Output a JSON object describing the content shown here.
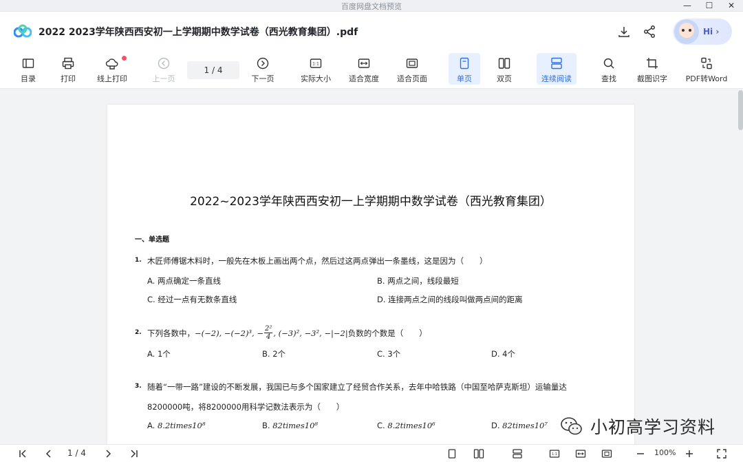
{
  "window": {
    "title": "百度网盘文档预览"
  },
  "header": {
    "file_title": "2022 2023学年陕西西安初一上学期期中数学试卷（西光教育集团）.pdf",
    "hi_label": "Hi ›"
  },
  "toolbar": {
    "toc": "目录",
    "print": "打印",
    "online_print": "线上打印",
    "prev": "上一页",
    "page": "1 / 4",
    "next": "下一页",
    "actual_size": "实际大小",
    "fit_width": "适合宽度",
    "fit_page": "适合页面",
    "single": "单页",
    "double": "双页",
    "continuous": "连续阅读",
    "find": "查找",
    "ocr": "截图识字",
    "to_word": "PDF转Word"
  },
  "doc": {
    "title": "2022~2023学年陕西西安初一上学期期中数学试卷（西光教育集团）",
    "section": "一、单选题",
    "q1": {
      "num": "1.",
      "text": "木匠师傅锯木料时，一般先在木板上画出两个点，然后过这两点弹出一条墨线，这是因为（　　）",
      "a": "A. 两点确定一条直线",
      "b": "B. 两点之间，线段最短",
      "c": "C. 经过一点有无数条直线",
      "d": "D. 连接两点之间的线段叫做两点间的距离"
    },
    "q2": {
      "num": "2.",
      "prefix": "下列各数中，",
      "expr1": "−(−2), −(−2)³, −",
      "frac_num": "2²",
      "frac_den": "4",
      "expr2": ", (−3)², −3², −|−2|",
      "suffix": "负数的个数是（　　）",
      "a": "A. 1个",
      "b": "B. 2个",
      "c": "C. 3个",
      "d": "D. 4个"
    },
    "q3": {
      "num": "3.",
      "line1": "随着“一带一路”建设的不断发展，我国已与多个国家建立了经贸合作关系，去年中哈铁路（中国至哈萨克斯坦）运输量达",
      "line2": "8200000吨，将8200000用科学记数法表示为（　　）",
      "a_label": "A. ",
      "a_math": "8.2times10⁸",
      "b_label": "B. ",
      "b_math": "82times10⁸",
      "c_label": "C. ",
      "c_math": "8.2times10⁶",
      "d_label": "D. ",
      "d_math": "82times10⁷"
    }
  },
  "watermark": {
    "text": "小初高学习资料"
  },
  "bottom": {
    "page": "1 / 4",
    "zoom": "100%"
  }
}
